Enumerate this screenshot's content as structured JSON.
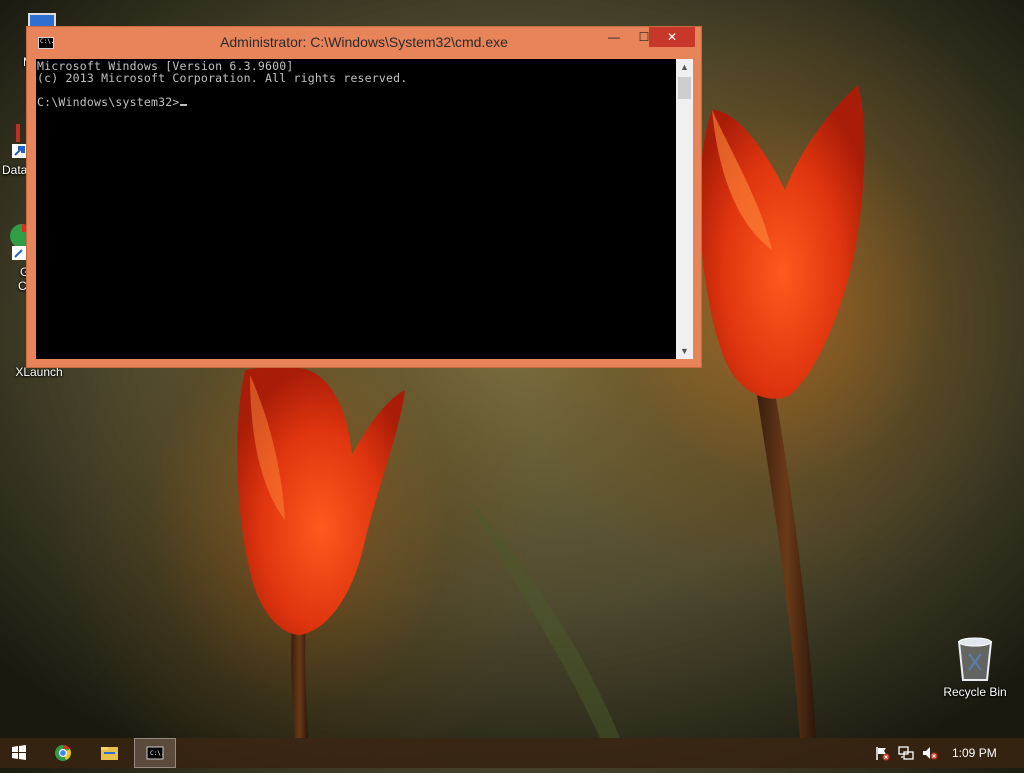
{
  "window": {
    "title": "Administrator: C:\\Windows\\System32\\cmd.exe",
    "icon_text": "C:\\.",
    "controls": {
      "minimize": "—",
      "maximize": "☐",
      "close": "✕"
    }
  },
  "console": {
    "lines": [
      "Microsoft Windows [Version 6.3.9600]",
      "(c) 2013 Microsoft Corporation. All rights reserved.",
      "",
      "C:\\Windows\\system32>"
    ],
    "scroll_up": "▲",
    "scroll_down": "▼"
  },
  "desktop_icons": [
    {
      "label": "My C",
      "icon": "computer-icon"
    },
    {
      "label": "Data",
      "icon": "shortcut-icon"
    },
    {
      "label": "G",
      "label2": "C",
      "icon": "chrome-shortcut-icon"
    },
    {
      "label": "XLaunch",
      "icon": "xlaunch-icon"
    },
    {
      "label": "Recycle Bin",
      "icon": "recycle-bin-icon"
    }
  ],
  "taskbar": {
    "items": [
      "start-icon",
      "chrome-icon",
      "file-explorer-icon",
      "cmd-icon"
    ],
    "cmd_label": "C:\\.",
    "tray": [
      "action-center-flag-icon",
      "network-icon",
      "volume-muted-icon"
    ],
    "clock": "1:09 PM"
  },
  "colors": {
    "window_frame": "#e8845a",
    "close_button": "#c7382a",
    "console_bg": "#000000",
    "console_text": "#c0c0c0"
  }
}
